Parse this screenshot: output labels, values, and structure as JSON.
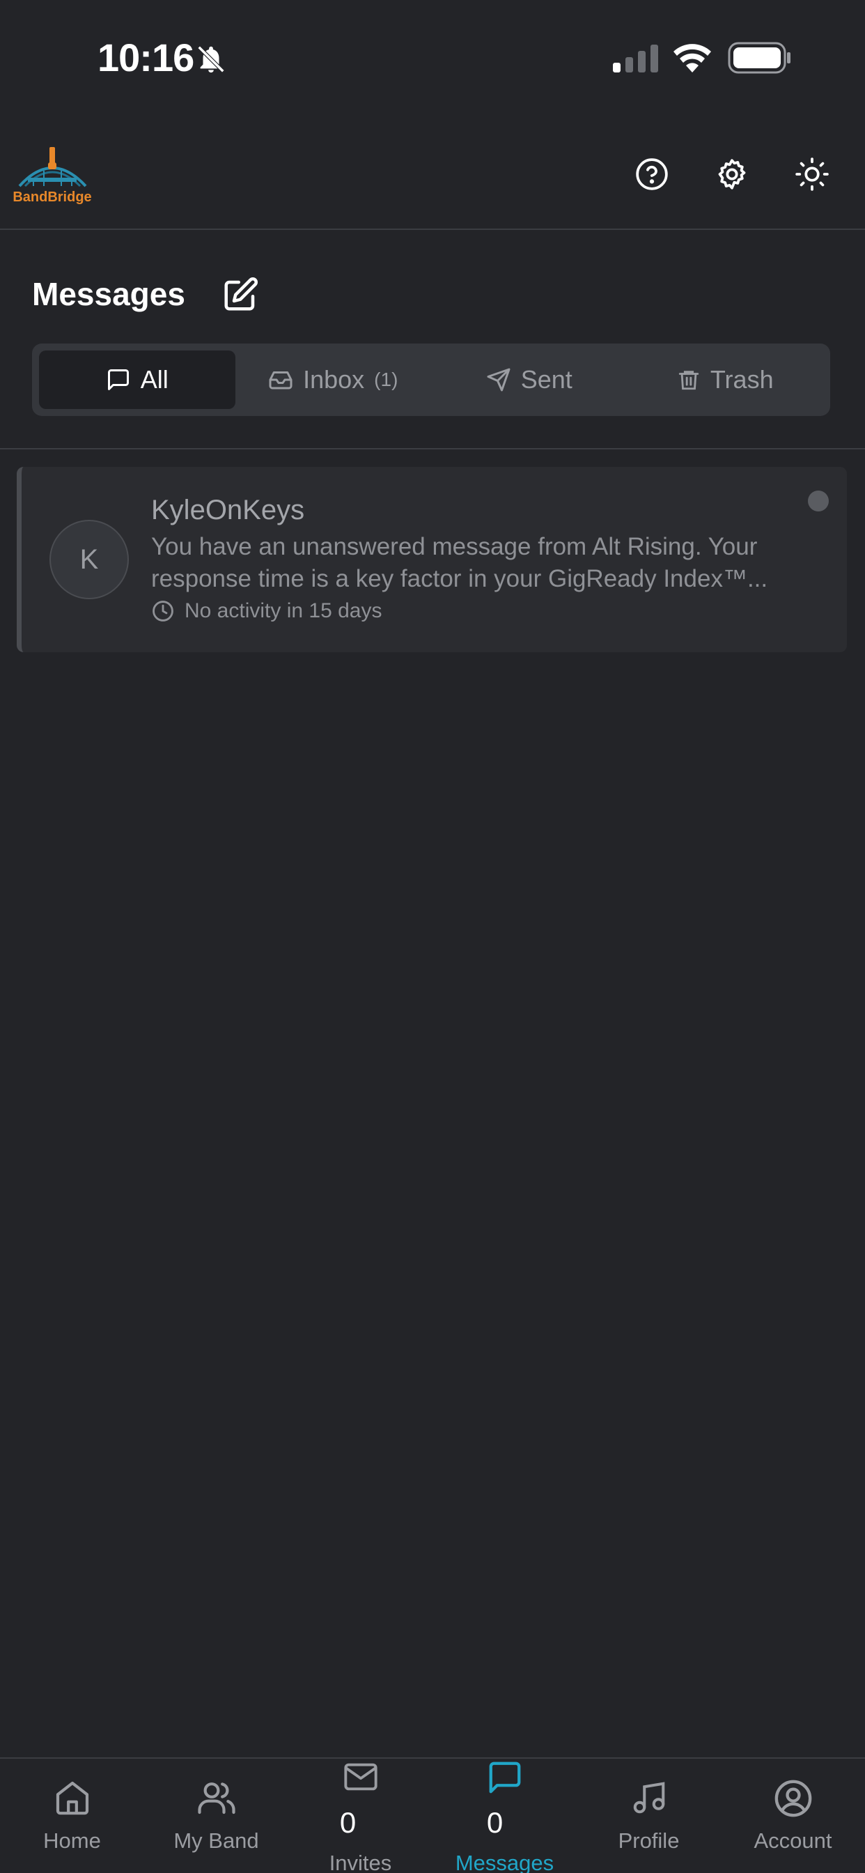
{
  "status_bar": {
    "time": "10:16"
  },
  "header": {
    "logo_text": "BandBridge"
  },
  "page": {
    "title": "Messages"
  },
  "tabs": [
    {
      "label": "All",
      "active": true
    },
    {
      "label": "Inbox",
      "count": "(1)"
    },
    {
      "label": "Sent"
    },
    {
      "label": "Trash"
    }
  ],
  "messages": [
    {
      "avatar_initial": "K",
      "sender": "KyleOnKeys",
      "preview": "You have an unanswered message from Alt Rising. Your response time is a key factor in your GigReady Index™...",
      "activity": "No activity in 15 days",
      "unread": true
    }
  ],
  "bottom_nav": {
    "items": [
      {
        "label": "Home",
        "icon": "home-icon"
      },
      {
        "label": "My Band",
        "icon": "users-icon"
      },
      {
        "label": "Invites",
        "icon": "mail-icon",
        "count": "0"
      },
      {
        "label": "Messages",
        "icon": "chat-icon",
        "count": "0",
        "active": true
      },
      {
        "label": "Profile",
        "icon": "music-note-icon"
      },
      {
        "label": "Account",
        "icon": "user-circle-icon"
      }
    ]
  },
  "colors": {
    "accent": "#21a6c8",
    "background": "#232428",
    "card": "#2b2c30"
  }
}
